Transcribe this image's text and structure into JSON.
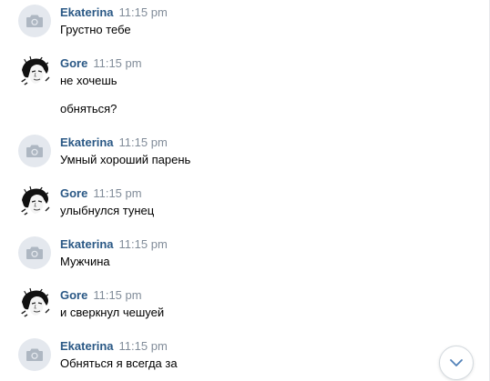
{
  "messages": [
    {
      "author": "Ekaterina",
      "time": "11:15 pm",
      "avatar": "camera-placeholder",
      "lines": [
        "Грустно тебе"
      ]
    },
    {
      "author": "Gore",
      "time": "11:15 pm",
      "avatar": "photo",
      "lines": [
        "не хочешь",
        "обняться?"
      ]
    },
    {
      "author": "Ekaterina",
      "time": "11:15 pm",
      "avatar": "camera-placeholder",
      "lines": [
        "Умный хороший парень"
      ]
    },
    {
      "author": "Gore",
      "time": "11:15 pm",
      "avatar": "photo",
      "lines": [
        "улыбнулся тунец"
      ]
    },
    {
      "author": "Ekaterina",
      "time": "11:15 pm",
      "avatar": "camera-placeholder",
      "lines": [
        "Мужчина"
      ]
    },
    {
      "author": "Gore",
      "time": "11:15 pm",
      "avatar": "photo",
      "lines": [
        "и сверкнул чешуей"
      ]
    },
    {
      "author": "Ekaterina",
      "time": "11:15 pm",
      "avatar": "camera-placeholder",
      "lines": [
        "Обняться я всегда за"
      ]
    }
  ],
  "colors": {
    "author": "#2a5885",
    "time": "#818c99",
    "text": "#000000",
    "placeholder_bg": "#e4e8ee",
    "placeholder_icon": "#aeb7c2"
  },
  "icons": {
    "placeholder": "camera-icon",
    "scroll_down": "chevron-down-icon"
  }
}
